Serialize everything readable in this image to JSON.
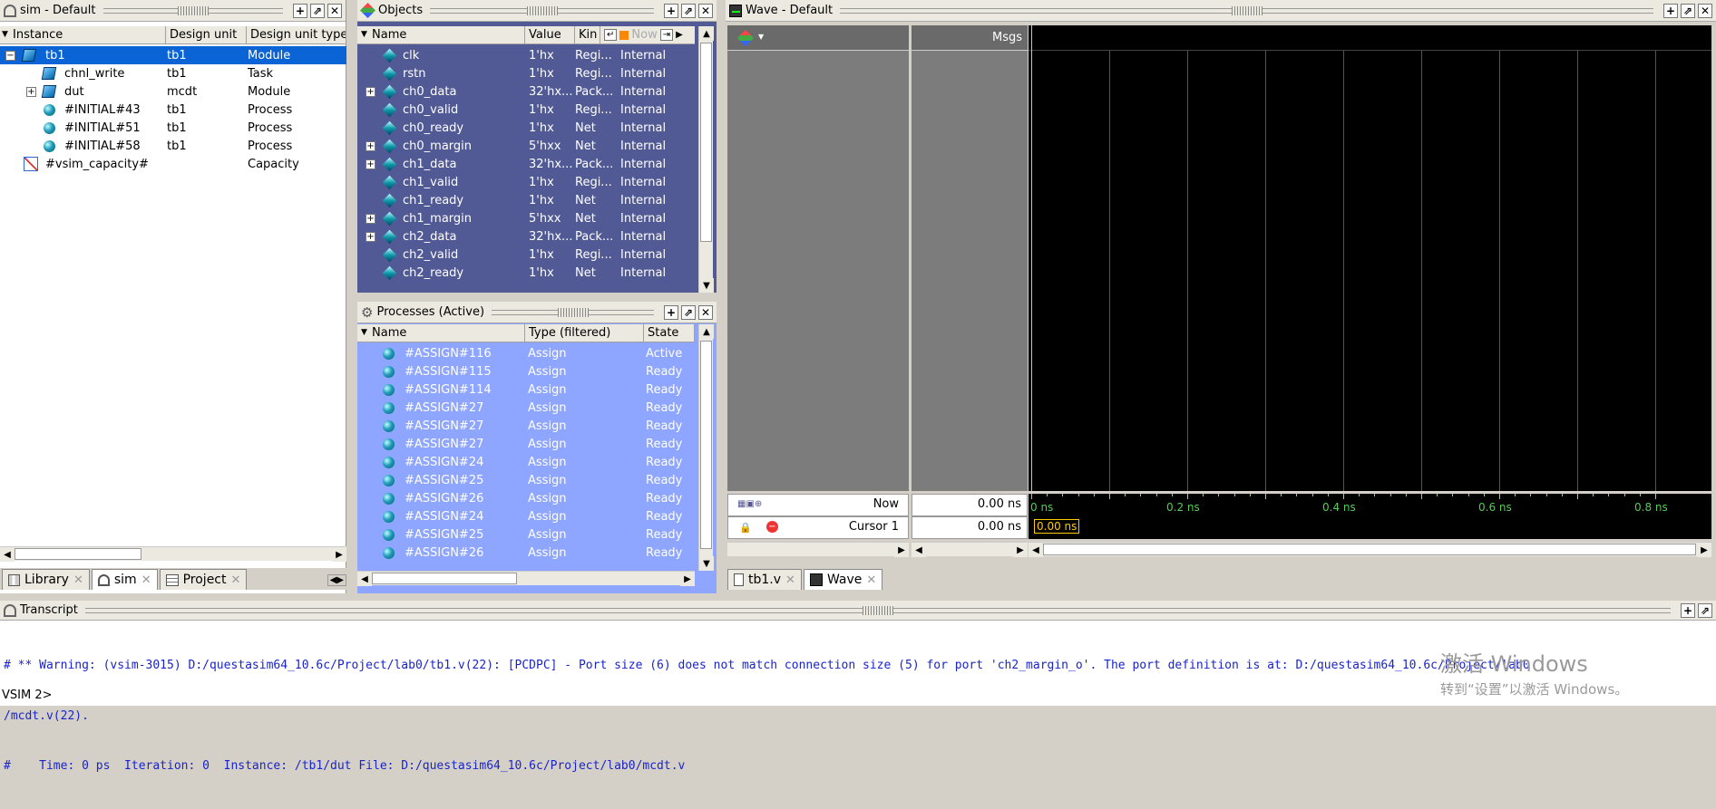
{
  "sim_panel": {
    "title": "sim - Default",
    "columns": [
      "Instance",
      "Design unit",
      "Design unit type"
    ],
    "rows": [
      {
        "instance": "tb1",
        "unit": "tb1",
        "type": "Module"
      },
      {
        "instance": "chnl_write",
        "unit": "tb1",
        "type": "Task"
      },
      {
        "instance": "dut",
        "unit": "mcdt",
        "type": "Module"
      },
      {
        "instance": "#INITIAL#43",
        "unit": "tb1",
        "type": "Process"
      },
      {
        "instance": "#INITIAL#51",
        "unit": "tb1",
        "type": "Process"
      },
      {
        "instance": "#INITIAL#58",
        "unit": "tb1",
        "type": "Process"
      },
      {
        "instance": "#vsim_capacity#",
        "unit": "",
        "type": "Capacity"
      }
    ],
    "tabs": [
      "Library",
      "sim",
      "Project"
    ]
  },
  "objects_panel": {
    "title": "Objects",
    "columns": [
      "Name",
      "Value",
      "Kin"
    ],
    "now_label": "Now",
    "rows": [
      {
        "name": "clk",
        "value": "1'hx",
        "kind": "Regi...",
        "mode": "Internal",
        "expand": false
      },
      {
        "name": "rstn",
        "value": "1'hx",
        "kind": "Regi...",
        "mode": "Internal",
        "expand": false
      },
      {
        "name": "ch0_data",
        "value": "32'hx...",
        "kind": "Pack...",
        "mode": "Internal",
        "expand": true
      },
      {
        "name": "ch0_valid",
        "value": "1'hx",
        "kind": "Regi...",
        "mode": "Internal",
        "expand": false
      },
      {
        "name": "ch0_ready",
        "value": "1'hx",
        "kind": "Net",
        "mode": "Internal",
        "expand": false
      },
      {
        "name": "ch0_margin",
        "value": "5'hxx",
        "kind": "Net",
        "mode": "Internal",
        "expand": true
      },
      {
        "name": "ch1_data",
        "value": "32'hx...",
        "kind": "Pack...",
        "mode": "Internal",
        "expand": true
      },
      {
        "name": "ch1_valid",
        "value": "1'hx",
        "kind": "Regi...",
        "mode": "Internal",
        "expand": false
      },
      {
        "name": "ch1_ready",
        "value": "1'hx",
        "kind": "Net",
        "mode": "Internal",
        "expand": false
      },
      {
        "name": "ch1_margin",
        "value": "5'hxx",
        "kind": "Net",
        "mode": "Internal",
        "expand": true
      },
      {
        "name": "ch2_data",
        "value": "32'hx...",
        "kind": "Pack...",
        "mode": "Internal",
        "expand": true
      },
      {
        "name": "ch2_valid",
        "value": "1'hx",
        "kind": "Regi...",
        "mode": "Internal",
        "expand": false
      },
      {
        "name": "ch2_ready",
        "value": "1'hx",
        "kind": "Net",
        "mode": "Internal",
        "expand": false
      }
    ]
  },
  "processes_panel": {
    "title": "Processes (Active)",
    "columns": [
      "Name",
      "Type (filtered)",
      "State"
    ],
    "rows": [
      {
        "name": "#ASSIGN#116",
        "type": "Assign",
        "state": "Active"
      },
      {
        "name": "#ASSIGN#115",
        "type": "Assign",
        "state": "Ready"
      },
      {
        "name": "#ASSIGN#114",
        "type": "Assign",
        "state": "Ready"
      },
      {
        "name": "#ASSIGN#27",
        "type": "Assign",
        "state": "Ready"
      },
      {
        "name": "#ASSIGN#27",
        "type": "Assign",
        "state": "Ready"
      },
      {
        "name": "#ASSIGN#27",
        "type": "Assign",
        "state": "Ready"
      },
      {
        "name": "#ASSIGN#24",
        "type": "Assign",
        "state": "Ready"
      },
      {
        "name": "#ASSIGN#25",
        "type": "Assign",
        "state": "Ready"
      },
      {
        "name": "#ASSIGN#26",
        "type": "Assign",
        "state": "Ready"
      },
      {
        "name": "#ASSIGN#24",
        "type": "Assign",
        "state": "Ready"
      },
      {
        "name": "#ASSIGN#25",
        "type": "Assign",
        "state": "Ready"
      },
      {
        "name": "#ASSIGN#26",
        "type": "Assign",
        "state": "Ready"
      }
    ]
  },
  "wave_panel": {
    "title": "Wave - Default",
    "msgs_label": "Msgs",
    "now_label": "Now",
    "now_value": "0.00 ns",
    "cursor_label": "Cursor 1",
    "cursor_value": "0.00 ns",
    "cursor_flag": "0.00 ns",
    "ticks": [
      "0 ns",
      "0.2 ns",
      "0.4 ns",
      "0.6 ns",
      "0.8 ns"
    ],
    "tabs": [
      "tb1.v",
      "Wave"
    ]
  },
  "transcript": {
    "title": "Transcript",
    "lines": [
      "# ** Warning: (vsim-3015) D:/questasim64_10.6c/Project/lab0/tb1.v(22): [PCDPC] - Port size (6) does not match connection size (5) for port 'ch2_margin_o'. The port definition is at: D:/questasim64_10.6c/Project/lab0",
      "/mcdt.v(22).",
      "#    Time: 0 ps  Iteration: 0  Instance: /tb1/dut File: D:/questasim64_10.6c/Project/lab0/mcdt.v"
    ],
    "prompt": "VSIM 2>"
  },
  "watermark": {
    "line1": "激活 Windows",
    "line2": "转到“设置”以激活 Windows。"
  },
  "colors": {
    "objects_bg": "#515a94",
    "processes_bg": "#8ea6ff",
    "selection": "#0a64d6",
    "wave_bg": "#000000",
    "cursor": "#ffcc00",
    "transcript_text": "#1a24c8"
  }
}
